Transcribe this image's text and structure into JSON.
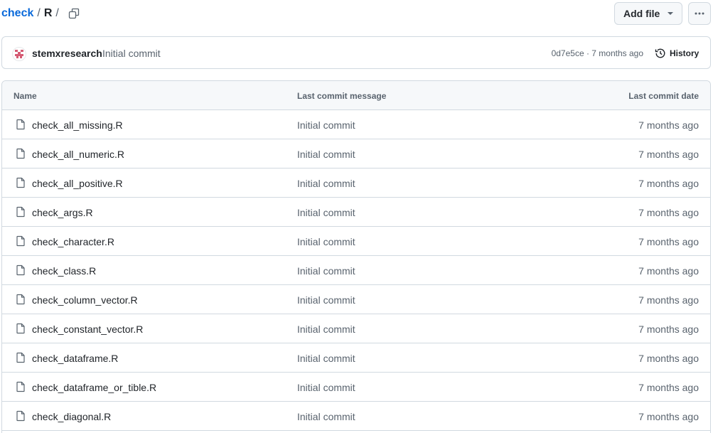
{
  "breadcrumb": {
    "repo": "check",
    "separator": "/",
    "dir": "R",
    "trailing_separator": "/"
  },
  "actions": {
    "add_file_label": "Add file",
    "more_label": "…"
  },
  "latest_commit": {
    "author": "stemxresearch",
    "message": "Initial commit",
    "hash_and_time": "0d7e5ce · 7 months ago",
    "history_label": "History"
  },
  "table": {
    "headers": {
      "name": "Name",
      "message": "Last commit message",
      "date": "Last commit date"
    },
    "rows": [
      {
        "name": "check_all_missing.R",
        "message": "Initial commit",
        "date": "7 months ago"
      },
      {
        "name": "check_all_numeric.R",
        "message": "Initial commit",
        "date": "7 months ago"
      },
      {
        "name": "check_all_positive.R",
        "message": "Initial commit",
        "date": "7 months ago"
      },
      {
        "name": "check_args.R",
        "message": "Initial commit",
        "date": "7 months ago"
      },
      {
        "name": "check_character.R",
        "message": "Initial commit",
        "date": "7 months ago"
      },
      {
        "name": "check_class.R",
        "message": "Initial commit",
        "date": "7 months ago"
      },
      {
        "name": "check_column_vector.R",
        "message": "Initial commit",
        "date": "7 months ago"
      },
      {
        "name": "check_constant_vector.R",
        "message": "Initial commit",
        "date": "7 months ago"
      },
      {
        "name": "check_dataframe.R",
        "message": "Initial commit",
        "date": "7 months ago"
      },
      {
        "name": "check_dataframe_or_tible.R",
        "message": "Initial commit",
        "date": "7 months ago"
      },
      {
        "name": "check_diagonal.R",
        "message": "Initial commit",
        "date": "7 months ago"
      }
    ]
  },
  "icons": {
    "copy": "copy-icon",
    "caret": "triangle-down-icon",
    "more": "kebab-horizontal-icon",
    "history": "history-icon",
    "file": "file-icon",
    "avatar": "identicon-avatar"
  },
  "colors": {
    "link": "#0969da",
    "muted": "#59636e",
    "border": "#d1d9e0",
    "header_bg": "#f6f8fa",
    "avatar_accent": "#d55c74"
  }
}
